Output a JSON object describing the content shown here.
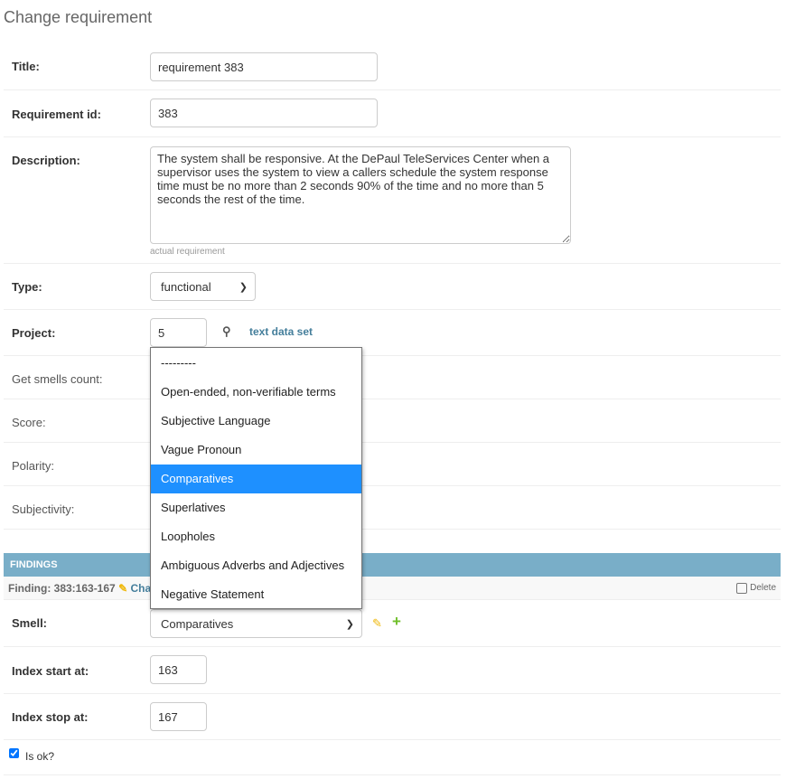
{
  "page_title": "Change requirement",
  "fields": {
    "title": {
      "label": "Title:",
      "value": "requirement 383"
    },
    "requirement_id": {
      "label": "Requirement id:",
      "value": "383"
    },
    "description": {
      "label": "Description:",
      "value": "The system shall be responsive. At the DePaul TeleServices Center when a supervisor uses the system to view a callers schedule the system response time must be no more than 2 seconds 90% of the time and no more than 5 seconds the rest of the time.",
      "help": "actual requirement"
    },
    "type": {
      "label": "Type:",
      "value": "functional"
    },
    "project": {
      "label": "Project:",
      "value": "5",
      "link": "text data set"
    },
    "get_smells_count": {
      "label": "Get smells count:"
    },
    "score": {
      "label": "Score:"
    },
    "polarity": {
      "label": "Polarity:"
    },
    "subjectivity": {
      "label": "Subjectivity:"
    }
  },
  "findings": {
    "header": "FINDINGS",
    "finding_title": "Finding: 383:163-167",
    "change_link": "Change",
    "delete_label": "Delete",
    "smell": {
      "label": "Smell:",
      "value": "Comparatives"
    },
    "index_start": {
      "label": "Index start at:",
      "value": "163"
    },
    "index_stop": {
      "label": "Index stop at:",
      "value": "167"
    },
    "is_ok": {
      "label": "Is ok?",
      "checked": true
    }
  },
  "dropdown": {
    "options": [
      "---------",
      "Open-ended, non-verifiable terms",
      "Subjective Language",
      "Vague Pronoun",
      "Comparatives",
      "Superlatives",
      "Loopholes",
      "Ambiguous Adverbs and Adjectives",
      "Negative Statement"
    ],
    "selected": "Comparatives"
  },
  "colors": {
    "header": "#79aec8",
    "link": "#447e9b",
    "selected": "#1e90ff",
    "pencil": "#efb80b",
    "plus": "#70bf2b"
  }
}
